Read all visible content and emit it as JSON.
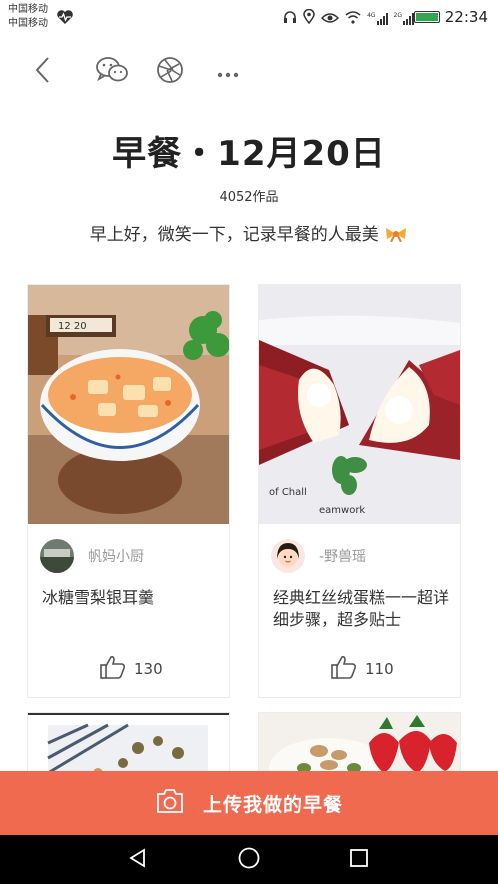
{
  "status": {
    "carrier_1": "中国移动",
    "carrier_2": "中国移动",
    "net_1": "4G",
    "net_2": "2G",
    "time": "22:34"
  },
  "header": {
    "title": "早餐・12月20日",
    "count": "4052作品",
    "subtitle": "早上好，微笑一下，记录早餐的人最美"
  },
  "cards": [
    {
      "author": "帆妈小厨",
      "title": "冰糖雪梨银耳羹",
      "likes": "130",
      "date_tag": "12 20"
    },
    {
      "author": "-野兽瑶",
      "title": "经典红丝绒蛋糕一一超详细步骤，超多贴士",
      "likes": "110"
    }
  ],
  "upload": {
    "label": "上传我做的早餐"
  },
  "colors": {
    "accent": "#f06a4f",
    "nav": "#000000"
  },
  "icons": [
    "heart-rate-icon",
    "back-icon",
    "wechat-icon",
    "moments-icon",
    "more-icon",
    "camera-icon",
    "thumbs-up-icon",
    "bow-icon"
  ]
}
